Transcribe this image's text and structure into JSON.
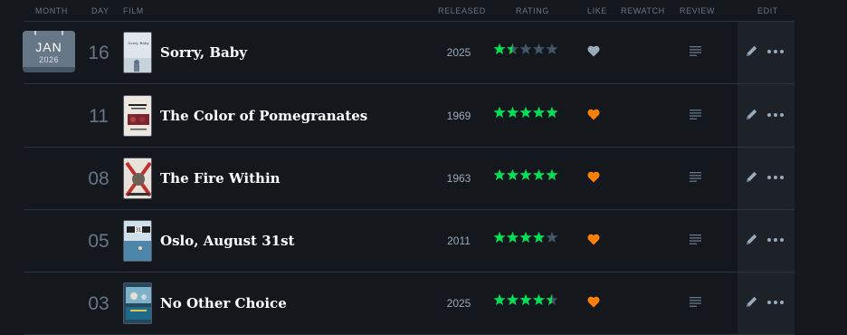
{
  "columns": {
    "month": "MONTH",
    "day": "DAY",
    "film": "FILM",
    "released": "RELEASED",
    "rating": "RATING",
    "like": "LIKE",
    "rewatch": "REWATCH",
    "review": "REVIEW",
    "edit": "EDIT"
  },
  "calendar": {
    "month": "JAN",
    "year": "2026"
  },
  "colors": {
    "star_green": "#00e054",
    "star_grey": "#456",
    "heart_orange": "#ff8000",
    "heart_grey": "#9ab"
  },
  "entries": [
    {
      "day": "16",
      "title": "Sorry, Baby",
      "released": "2025",
      "rating": 1.5,
      "liked": false,
      "poster": "sorry-baby-poster",
      "poster_text": "Sorry, Baby"
    },
    {
      "day": "11",
      "title": "The Color of Pomegranates",
      "released": "1969",
      "rating": 5,
      "liked": true,
      "poster": "the-color-of-pomegranates-poster"
    },
    {
      "day": "08",
      "title": "The Fire Within",
      "released": "1963",
      "rating": 5,
      "liked": true,
      "poster": "the-fire-within-poster"
    },
    {
      "day": "05",
      "title": "Oslo, August 31st",
      "released": "2011",
      "rating": 4,
      "liked": true,
      "poster": "oslo-august-31st-poster",
      "poster_text": "31"
    },
    {
      "day": "03",
      "title": "No Other Choice",
      "released": "2025",
      "rating": 4.5,
      "liked": true,
      "poster": "no-other-choice-poster"
    }
  ]
}
